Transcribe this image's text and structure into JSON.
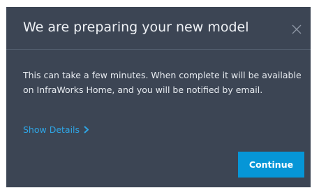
{
  "dialog": {
    "title": "We are preparing your new model",
    "close_icon": "close-icon",
    "message": "This can take a few minutes. When complete it will be available on InfraWorks Home, and you will be notified by email.",
    "details_link_label": "Show Details",
    "details_icon": "chevron-right-icon",
    "continue_label": "Continue"
  },
  "colors": {
    "dialog_background": "#3c4554",
    "link": "#2fa6e6",
    "primary_button": "#0696d7"
  }
}
